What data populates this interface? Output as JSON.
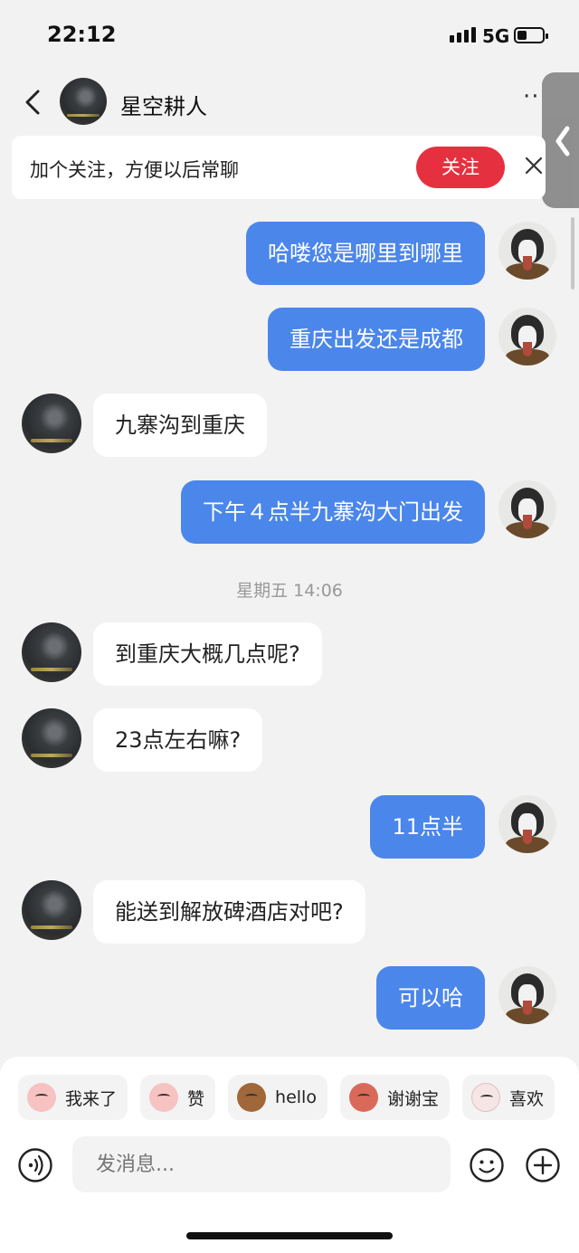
{
  "status": {
    "time": "22:12",
    "network": "5G"
  },
  "nav": {
    "title": "星空耕人",
    "more": "··"
  },
  "follow": {
    "text": "加个关注，方便以后常聊",
    "button": "关注"
  },
  "messages": [
    {
      "from": "me",
      "text": "哈喽您是哪里到哪里"
    },
    {
      "from": "me",
      "text": "重庆出发还是成都"
    },
    {
      "from": "them",
      "text": "九寨沟到重庆"
    },
    {
      "from": "me",
      "text": "下午４点半九寨沟大门出发"
    },
    {
      "from": "them",
      "text": "到重庆大概几点呢?"
    },
    {
      "from": "them",
      "text": "23点左右嘛?"
    },
    {
      "from": "me",
      "text": "11点半"
    },
    {
      "from": "them",
      "text": "能送到解放碑酒店对吧?"
    },
    {
      "from": "me",
      "text": "可以哈"
    }
  ],
  "timestamp": "星期五 14:06",
  "quick_replies": [
    {
      "label": "我来了",
      "icon": "pink-face-emoji"
    },
    {
      "label": "赞",
      "icon": "pink-face-emoji"
    },
    {
      "label": "hello",
      "icon": "monkey-emoji"
    },
    {
      "label": "谢谢宝",
      "icon": "monkey-emoji"
    },
    {
      "label": "喜欢",
      "icon": "white-face-emoji"
    }
  ],
  "input": {
    "placeholder": "发消息..."
  }
}
